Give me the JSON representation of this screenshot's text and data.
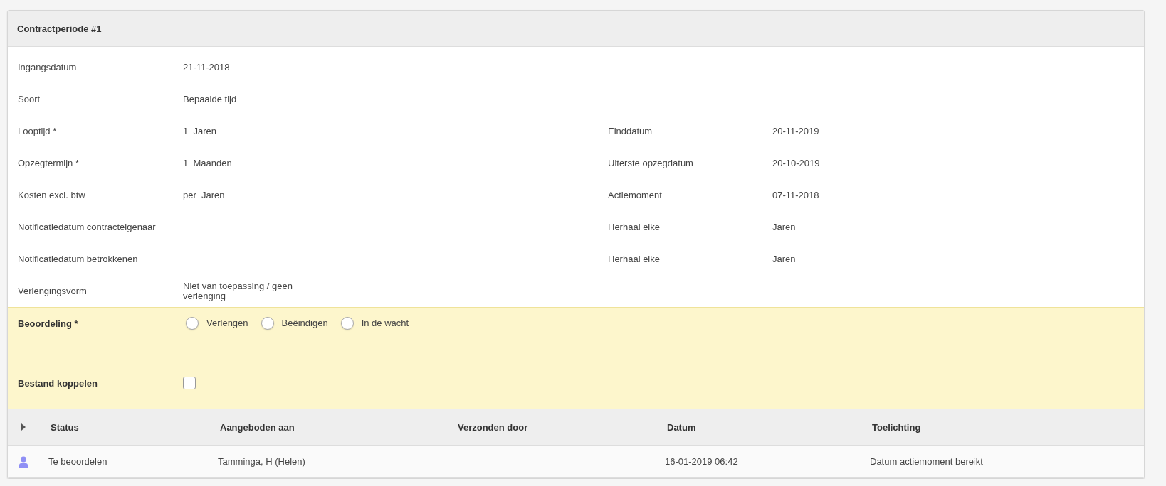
{
  "panel": {
    "title": "Contractperiode #1"
  },
  "fields": [
    {
      "left": {
        "label": "Ingangsdatum",
        "value": "21-11-2018"
      }
    },
    {
      "left": {
        "label": "Soort",
        "value": "Bepaalde tijd"
      }
    },
    {
      "left": {
        "label": "Looptijd *",
        "value": "1  Jaren"
      },
      "right": {
        "label": "Einddatum",
        "value": "20-11-2019"
      }
    },
    {
      "left": {
        "label": "Opzegtermijn *",
        "value": "1  Maanden"
      },
      "right": {
        "label": "Uiterste opzegdatum",
        "value": "20-10-2019"
      }
    },
    {
      "left": {
        "label": "Kosten excl. btw",
        "value": "per  Jaren"
      },
      "right": {
        "label": "Actiemoment",
        "value": "07-11-2018"
      }
    },
    {
      "left": {
        "label": "Notificatiedatum contracteigenaar"
      },
      "right": {
        "label": "Herhaal elke",
        "value": "Jaren"
      }
    },
    {
      "left": {
        "label": "Notificatiedatum betrokkenen"
      },
      "right": {
        "label": "Herhaal elke",
        "value": "Jaren"
      }
    },
    {
      "left": {
        "label": "Verlengingsvorm",
        "value": "Niet van toepassing / geen verlenging"
      }
    }
  ],
  "assessment": {
    "label": "Beoordeling *",
    "options": [
      {
        "label": "Verlengen",
        "selected": false
      },
      {
        "label": "Beëindigen",
        "selected": false
      },
      {
        "label": "In de wacht",
        "selected": false
      }
    ]
  },
  "attach_file": {
    "label": "Bestand koppelen",
    "checked": false
  },
  "table": {
    "expanded": false,
    "columns": [
      "Status",
      "Aangeboden aan",
      "Verzonden door",
      "Datum",
      "Toelichting"
    ],
    "rows": [
      {
        "cells": [
          "Te beoordelen",
          "Tamminga, H (Helen)",
          "",
          "16-01-2019 06:42",
          "Datum actiemoment bereikt"
        ]
      }
    ]
  }
}
